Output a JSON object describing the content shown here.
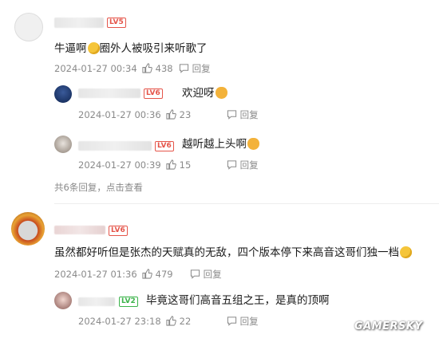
{
  "comments": [
    {
      "level": "LV5",
      "content": "牛逼啊",
      "content2": "圈外人被吸引来听歌了",
      "time": "2024-01-27 00:34",
      "likes": "438",
      "reply_label": "回复"
    },
    {
      "level": "LV6",
      "content": "欢迎呀",
      "time": "2024-01-27 00:36",
      "likes": "23",
      "reply_label": "回复"
    },
    {
      "level": "LV6",
      "content": "越听越上头啊",
      "time": "2024-01-27 00:39",
      "likes": "15",
      "reply_label": "回复"
    },
    {
      "level": "LV6",
      "content": "虽然都好听但是张杰的天赋真的无敌，四个版本停下来高音这哥们独一档",
      "time": "2024-01-27 01:36",
      "likes": "479",
      "reply_label": "回复"
    },
    {
      "level": "LV2",
      "content": "毕竟这哥们高音五组之王，是真的顶啊",
      "time": "2024-01-27 23:18",
      "likes": "22",
      "reply_label": "回复"
    }
  ],
  "more_replies": "共6条回复，点击查看",
  "watermark": "GAMERSKY",
  "colors": {
    "level_red": "#e5554a",
    "level_green": "#3bb34a",
    "meta_gray": "#8a8a8a"
  },
  "icons": {
    "like": "thumbs-up-icon",
    "reply": "chat-bubble-icon",
    "emoji_a": "sweat-smile-emoji",
    "emoji_b": "cat-emoji"
  }
}
